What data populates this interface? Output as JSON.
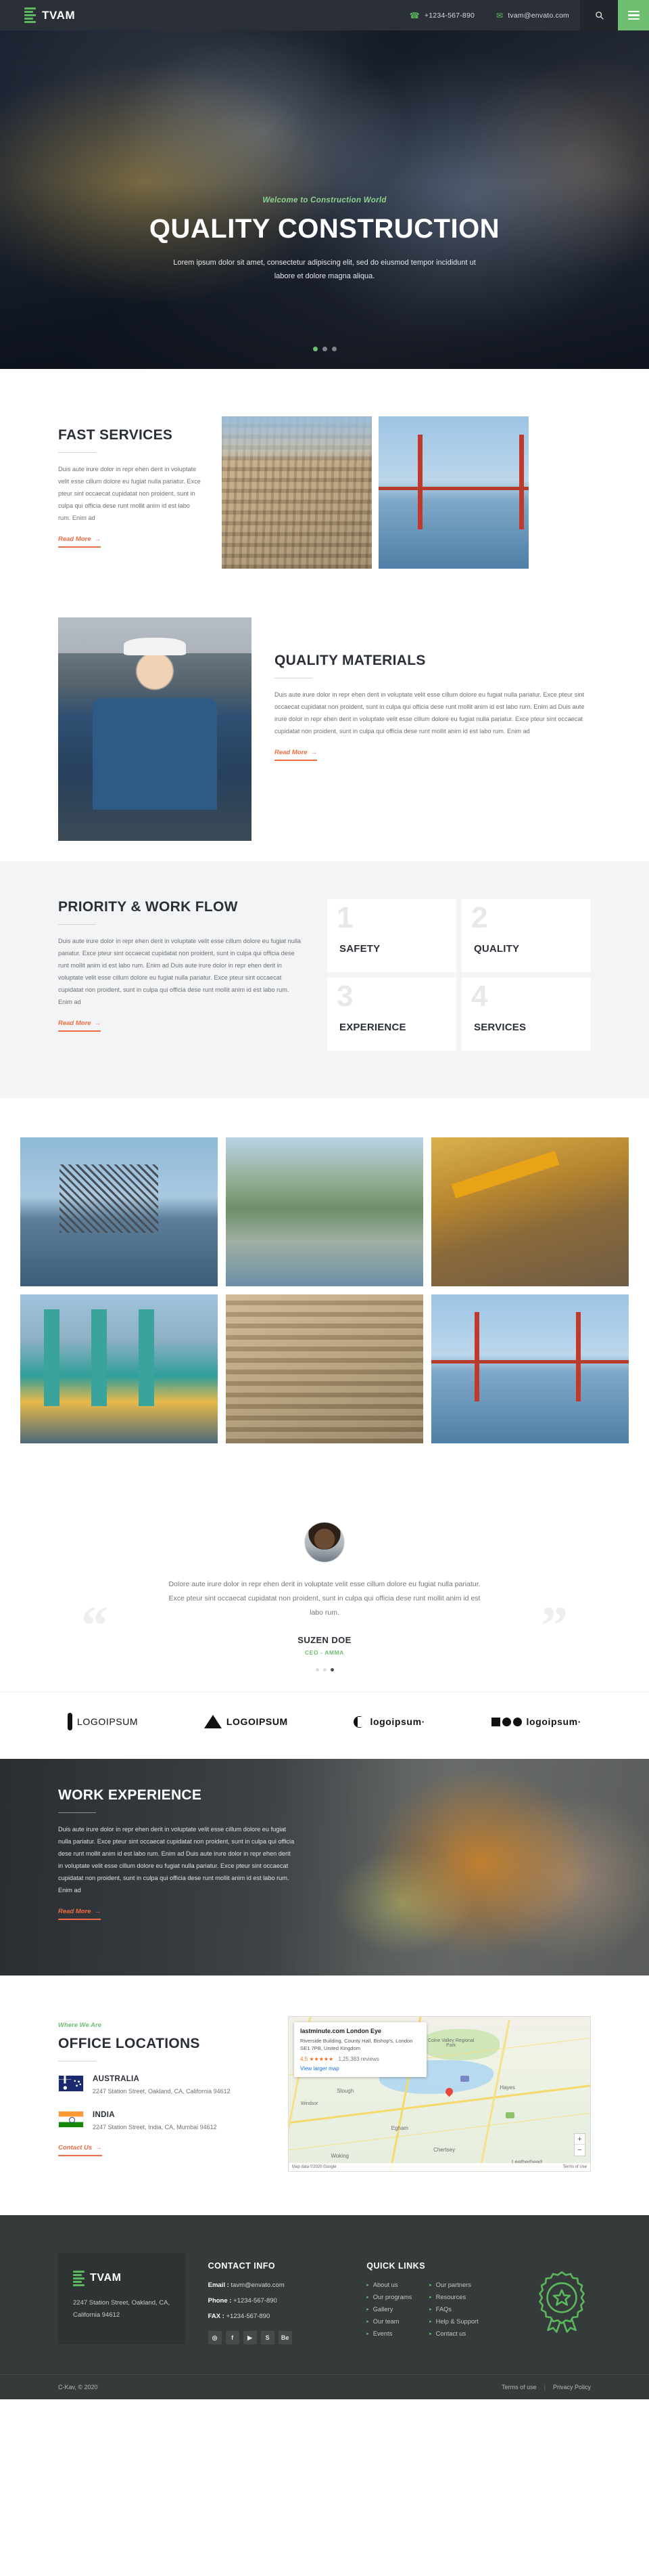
{
  "topbar": {
    "brand": "TVAM",
    "phone": "+1234-567-890",
    "email": "tvam@envato.com",
    "phone_icon": "phone-icon",
    "email_icon": "envelope-icon",
    "search_icon": "search-icon",
    "menu_icon": "hamburger-menu-icon"
  },
  "hero": {
    "kicker": "Welcome to Construction World",
    "title": "QUALITY CONSTRUCTION",
    "subtitle": "Lorem ipsum dolor sit amet, consectetur adipiscing elit, sed do eiusmod tempor incididunt ut labore et dolore magna aliqua."
  },
  "fast_services": {
    "title": "FAST SERVICES",
    "body": "Duis aute irure dolor in repr ehen derit in voluptate velit esse cillum dolore eu fugiat nulla pariatur. Exce pteur sint occaecat cupidatat non proident, sunt in culpa qui officia dese runt mollit anim id est labo rum. Enim ad",
    "read_more": "Read More"
  },
  "quality_materials": {
    "title": "QUALITY MATERIALS",
    "body": "Duis aute irure dolor in repr ehen derit in voluptate velit esse cillum dolore eu fugiat nulla pariatur. Exce pteur sint occaecat cupidatat non proident, sunt in culpa qui officia dese runt mollit anim id est labo rum. Enim ad  Duis aute irure dolor in repr ehen derit in voluptate velit esse cillum dolore eu fugiat nulla pariatur. Exce pteur sint occaecat cupidatat non proident, sunt in culpa qui officia dese runt mollit anim id est labo rum. Enim ad",
    "read_more": "Read More"
  },
  "priority": {
    "title": "PRIORITY & WORK FLOW",
    "body": "Duis aute irure dolor in repr ehen derit in voluptate velit esse cillum dolore eu fugiat nulla pariatur. Exce pteur sint occaecat cupidatat non proident, sunt in culpa qui officia dese runt mollit anim id est labo rum. Enim ad  Duis aute irure dolor in repr ehen derit in voluptate velit esse cillum dolore eu fugiat nulla pariatur. Exce pteur sint occaecat cupidatat non proident, sunt in culpa qui officia dese runt mollit anim id est labo rum. Enim ad",
    "read_more": "Read More",
    "boxes": [
      {
        "num": "1",
        "label": "SAFETY"
      },
      {
        "num": "2",
        "label": "QUALITY"
      },
      {
        "num": "3",
        "label": "EXPERIENCE"
      },
      {
        "num": "4",
        "label": "SERVICES"
      }
    ]
  },
  "testimonial": {
    "quote": "Dolore aute irure dolor in repr ehen derit in voluptate velit esse cillum dolore eu fugiat nulla pariatur. Exce pteur sint occaecat cupidatat non proident, sunt in culpa qui officia dese runt mollit anim id est labo rum.",
    "name": "SUZEN DOE",
    "role": "CEO - AMMA"
  },
  "clients": [
    {
      "name": "LOGOIPSUM",
      "glyph": "wheat-spike-icon"
    },
    {
      "name": "LOGOIPSUM",
      "glyph": "mountain-icon"
    },
    {
      "name": "logoipsum·",
      "glyph": "half-moon-icon"
    },
    {
      "name": "logoipsum·",
      "glyph": "shapes-icon"
    }
  ],
  "work_experience": {
    "title": "WORK EXPERIENCE",
    "body": "Duis aute irure dolor in repr ehen derit in voluptate velit esse cillum dolore eu fugiat nulla pariatur. Exce pteur sint occaecat cupidatat non proident, sunt in culpa qui officia dese runt mollit anim id est labo rum. Enim ad  Duis aute irure dolor in repr ehen derit in voluptate velit esse cillum dolore eu fugiat nulla pariatur. Exce pteur sint occaecat cupidatat non proident, sunt in culpa qui officia dese runt mollit anim id est labo rum. Enim ad",
    "read_more": "Read More"
  },
  "office": {
    "kicker": "Where We Are",
    "title": "OFFICE LOCATIONS",
    "contact_label": "Contact Us",
    "locations": [
      {
        "flag": "australia-flag-icon",
        "name": "AUSTRALIA",
        "address": "2247 Station Street, Oakland, CA, California 94612"
      },
      {
        "flag": "india-flag-icon",
        "name": "INDIA",
        "address": "2247 Station Street, India, CA, Mumbai 94612"
      }
    ],
    "map": {
      "card_title": "lastminute.com London Eye",
      "card_address": "Riverside Building, County Hall, Bishop's, London SE1 7PB, United Kingdom",
      "rating": "4.5 ★★★★★",
      "rating_count": "1,25,383 reviews",
      "view_larger": "View larger map",
      "labels": [
        "Colne Valley Regional Park",
        "Slough",
        "Hayes",
        "Windsor",
        "Egham",
        "Chertsey",
        "Woking",
        "Leatherhead"
      ],
      "zoom_in": "+",
      "zoom_out": "−",
      "attribution": "Map data ©2020 Google",
      "terms": "Terms of Use"
    }
  },
  "footer": {
    "brand": "TVAM",
    "address": "2247  Station Street, Oakland, CA, California 94612",
    "contact_title": "CONTACT INFO",
    "email_label": "Email :",
    "email_value": "tavm@envato.com",
    "phone_label": "Phone :",
    "phone_value": "+1234-567-890",
    "fax_label": "FAX :",
    "fax_value": "+1234-567-890",
    "socials": [
      "instagram-icon",
      "facebook-icon",
      "youtube-icon",
      "skype-icon",
      "behance-icon"
    ],
    "social_glyphs": [
      "◎",
      "f",
      "▶",
      "S",
      "Be"
    ],
    "quick_title": "QUICK LINKS",
    "quick_links_col1": [
      "About us",
      "Our programs",
      "Gallery",
      "Our team",
      "Events"
    ],
    "quick_links_col2": [
      "Our partners",
      "Resources",
      "FAQs",
      "Help & Support",
      "Contact us"
    ],
    "badge_icon": "award-ribbon-icon",
    "copyright": "C-Kav, © 2020",
    "terms": "Terms of use",
    "privacy": "Privacy Policy"
  },
  "colors": {
    "accent_green": "#6fbf73",
    "accent_orange": "#ef6c44",
    "dark": "#2b3038",
    "footer_bg": "#353b3a"
  }
}
